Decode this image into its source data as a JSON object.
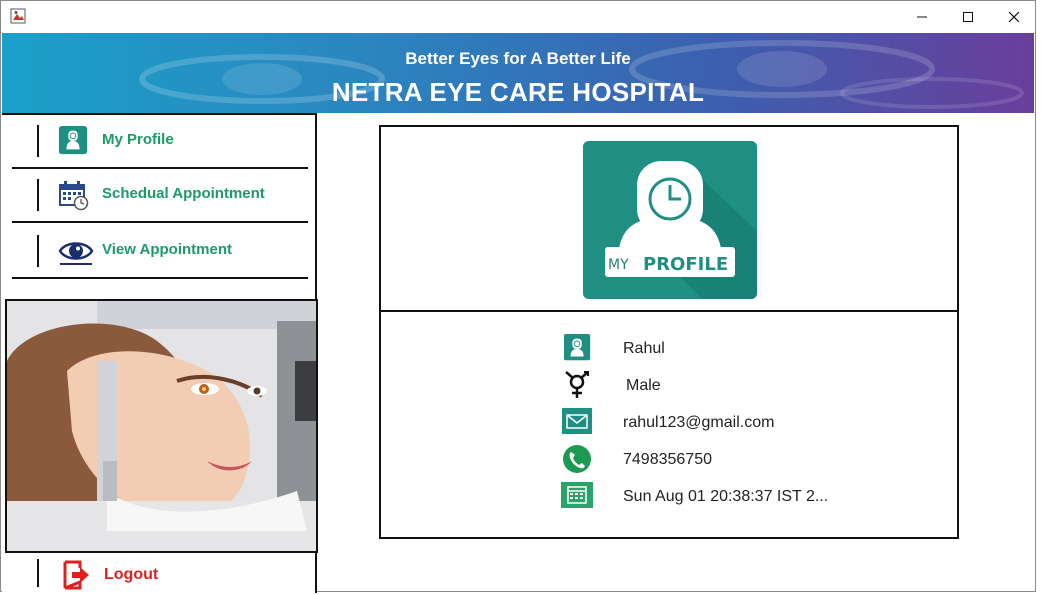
{
  "window": {
    "title": ""
  },
  "header": {
    "tagline": "Better Eyes for A Better Life",
    "hospital_name": "NETRA EYE CARE HOSPITAL"
  },
  "sidebar": {
    "items": [
      {
        "label": "My Profile",
        "icon": "profile-icon"
      },
      {
        "label": "Schedual Appointment",
        "icon": "calendar-clock-icon"
      },
      {
        "label": "View Appointment",
        "icon": "eye-icon"
      }
    ],
    "logout_label": "Logout"
  },
  "profile": {
    "card_text_my": "MY",
    "card_text_profile": "PROFILE",
    "name": "Rahul",
    "gender": "Male",
    "email": "rahul123@gmail.com",
    "phone": "7498356750",
    "date": "Sun Aug 01 20:38:37 IST 2..."
  },
  "colors": {
    "accent_green": "#1b9a6a",
    "teal": "#1f8f84",
    "logout_red": "#e02020"
  }
}
